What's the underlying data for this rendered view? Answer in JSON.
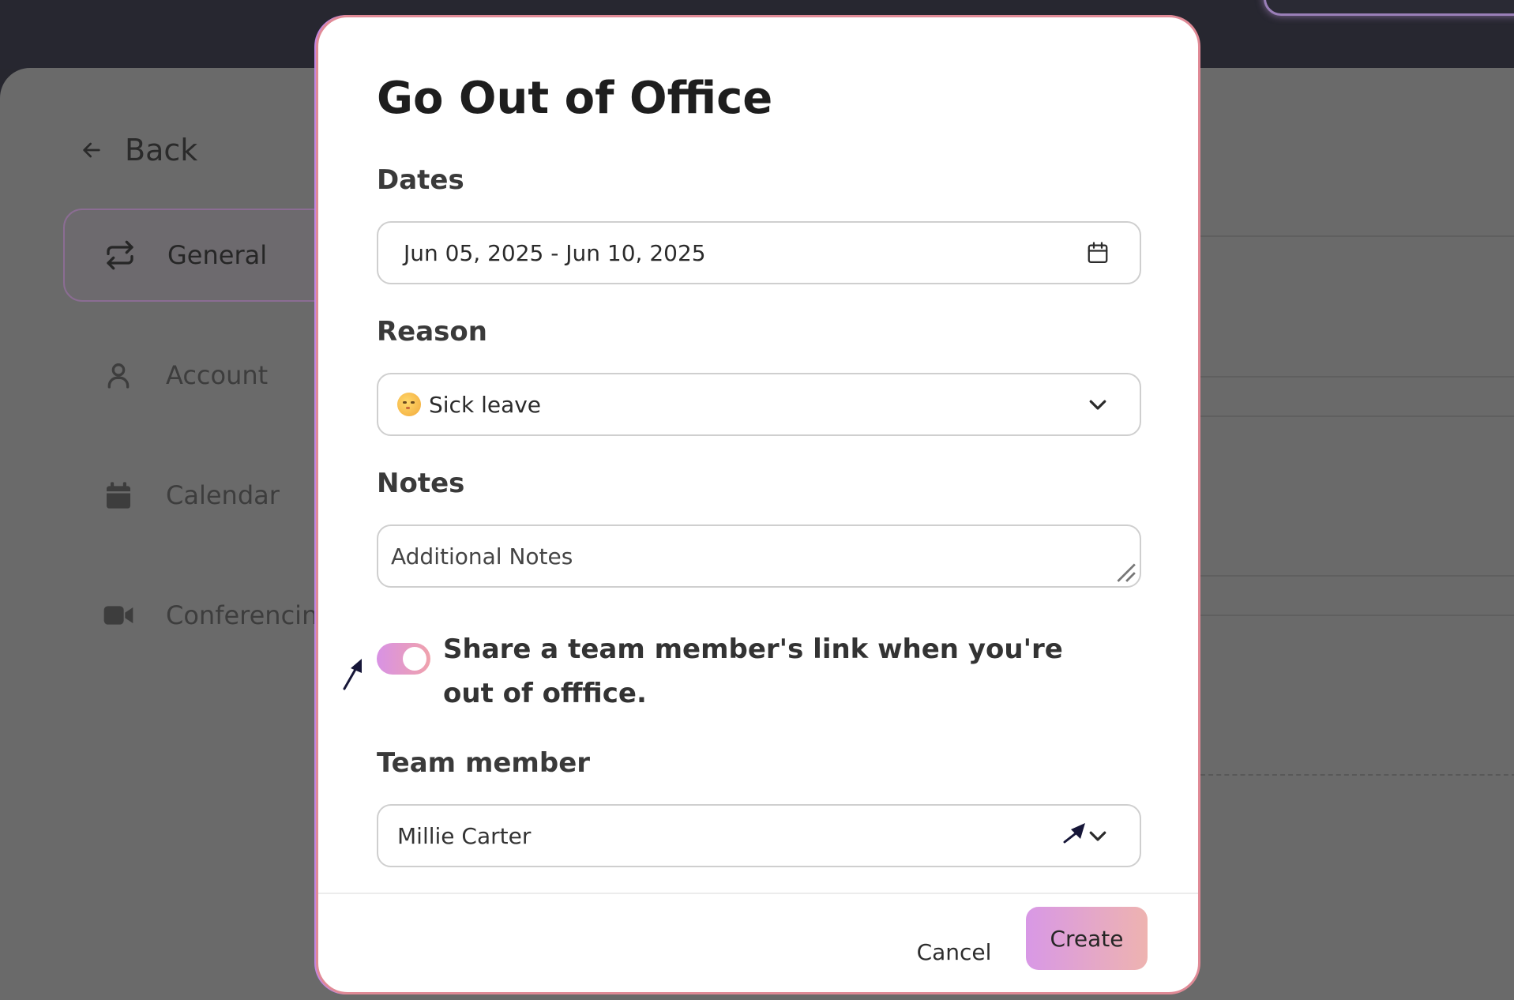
{
  "background": {
    "back_label": "Back",
    "nav": {
      "general": "General",
      "account": "Account",
      "calendar": "Calendar",
      "conferencing": "Conferencing"
    }
  },
  "modal": {
    "title": "Go Out of Office",
    "dates": {
      "label": "Dates",
      "value": "Jun 05, 2025 - Jun 10, 2025",
      "icon": "calendar-icon"
    },
    "reason": {
      "label": "Reason",
      "value": "Sick leave",
      "icon": "face-with-thermometer-emoji"
    },
    "notes": {
      "label": "Notes",
      "placeholder": "Additional Notes"
    },
    "share_toggle": {
      "label": "Share a team member's link when you're out of offfice.",
      "checked": true
    },
    "team_member": {
      "label": "Team member",
      "value": "Millie Carter"
    },
    "buttons": {
      "cancel": "Cancel",
      "create": "Create"
    }
  },
  "colors": {
    "accent_gradient_start": "#d892e4",
    "accent_gradient_end": "#f0a2ac",
    "modal_border": "#e08a96",
    "overlay": "#6a6a6a"
  }
}
